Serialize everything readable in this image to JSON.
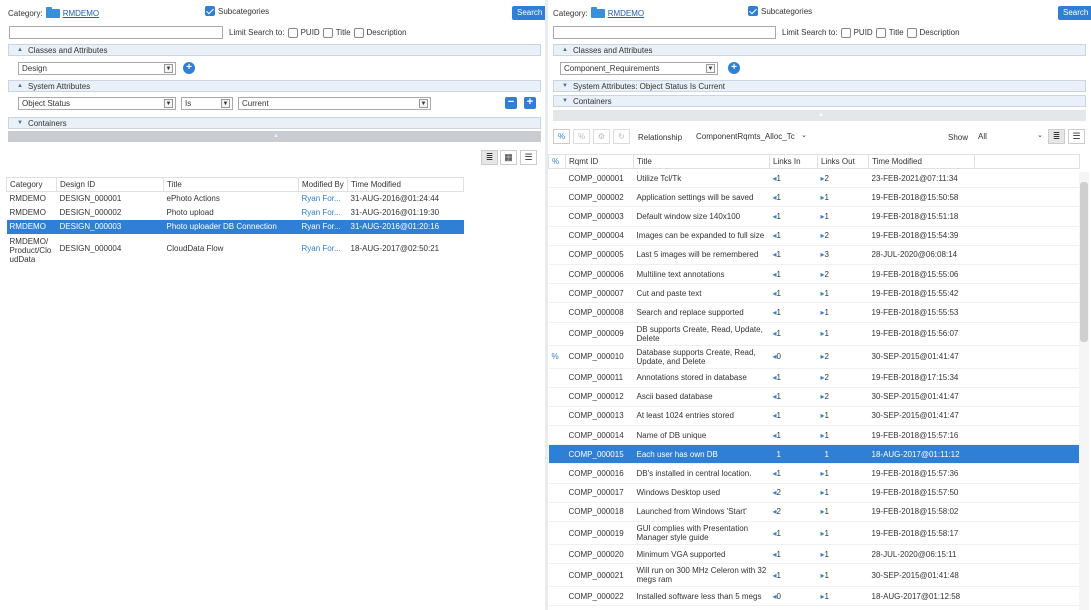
{
  "left": {
    "category_label": "Category:",
    "category_value": "RMDEMO",
    "subcategories_label": "Subcategories",
    "search_button": "Search",
    "limit_label": "Limit Search to:",
    "limit_options": [
      "PUID",
      "Title",
      "Description"
    ],
    "section_classes": "Classes and Attributes",
    "class_select": "Design",
    "section_system": "System Attributes",
    "attr_select": "Object Status",
    "op_select": "Is",
    "value_select": "Current",
    "section_containers": "Containers",
    "table": {
      "headers": [
        "Category",
        "Design ID",
        "Title",
        "Modified By",
        "Time Modified"
      ],
      "rows": [
        {
          "category": "RMDEMO",
          "id": "DESIGN_000001",
          "title": "ePhoto Actions",
          "by": "Ryan For...",
          "time": "31-AUG-2016@01:24:44"
        },
        {
          "category": "RMDEMO",
          "id": "DESIGN_000002",
          "title": "Photo upload",
          "by": "Ryan For...",
          "time": "31-AUG-2016@01:19:30"
        },
        {
          "category": "RMDEMO",
          "id": "DESIGN_000003",
          "title": "Photo uploader DB Connection",
          "by": "Ryan For...",
          "time": "31-AUG-2016@01:20:16"
        },
        {
          "category_lines": [
            "RMDEMO/",
            "Product/Clo",
            "udData"
          ],
          "id": "DESIGN_000004",
          "title": "CloudData Flow",
          "by": "Ryan For...",
          "time": "18-AUG-2017@02:50:21"
        }
      ]
    }
  },
  "right": {
    "category_label": "Category:",
    "category_value": "RMDEMO",
    "subcategories_label": "Subcategories",
    "search_button": "Search",
    "limit_label": "Limit Search to:",
    "limit_options": [
      "PUID",
      "Title",
      "Description"
    ],
    "section_classes": "Classes and Attributes",
    "class_select": "Component_Requirements",
    "section_system": "System Attributes: Object Status Is Current",
    "section_containers": "Containers",
    "relationship_label": "Relationship",
    "relationship_value": "ComponentRqmts_Alloc_Tc",
    "show_label": "Show",
    "show_value": "All",
    "table": {
      "headers": [
        "Rqmt ID",
        "Title",
        "Links In",
        "Links Out",
        "Time Modified"
      ],
      "rows": [
        {
          "id": "COMP_000001",
          "title": [
            "Utilize Tcl/Tk"
          ],
          "in": "1",
          "out": "2",
          "time": "23-FEB-2021@07:11:34"
        },
        {
          "id": "COMP_000002",
          "title": [
            "Application settings will be saved"
          ],
          "in": "1",
          "out": "1",
          "time": "19-FEB-2018@15:50:58"
        },
        {
          "id": "COMP_000003",
          "title": [
            "Default window size 140x100"
          ],
          "in": "1",
          "out": "1",
          "time": "19-FEB-2018@15:51:18"
        },
        {
          "id": "COMP_000004",
          "title": [
            "Images can be expanded to full size"
          ],
          "in": "1",
          "out": "2",
          "time": "19-FEB-2018@15:54:39"
        },
        {
          "id": "COMP_000005",
          "title": [
            "Last 5 images will be remembered"
          ],
          "in": "1",
          "out": "3",
          "time": "28-JUL-2020@06:08:14"
        },
        {
          "id": "COMP_000006",
          "title": [
            "Multiline text annotations"
          ],
          "in": "1",
          "out": "2",
          "time": "19-FEB-2018@15:55:06"
        },
        {
          "id": "COMP_000007",
          "title": [
            "Cut and paste text"
          ],
          "in": "1",
          "out": "1",
          "time": "19-FEB-2018@15:55:42"
        },
        {
          "id": "COMP_000008",
          "title": [
            "Search and replace supported"
          ],
          "in": "1",
          "out": "1",
          "time": "19-FEB-2018@15:55:53"
        },
        {
          "id": "COMP_000009",
          "title": [
            "DB supports Create, Read, Update,",
            "Delete"
          ],
          "in": "1",
          "out": "1",
          "time": "19-FEB-2018@15:56:07"
        },
        {
          "id": "COMP_000010",
          "title": [
            "Database supports Create, Read,",
            "Update, and Delete"
          ],
          "in": "0",
          "out": "2",
          "time": "30-SEP-2015@01:41:47",
          "linked": true
        },
        {
          "id": "COMP_000011",
          "title": [
            "Annotations stored in database"
          ],
          "in": "1",
          "out": "2",
          "time": "19-FEB-2018@17:15:34"
        },
        {
          "id": "COMP_000012",
          "title": [
            "Ascii based database"
          ],
          "in": "1",
          "out": "2",
          "time": "30-SEP-2015@01:41:47"
        },
        {
          "id": "COMP_000013",
          "title": [
            "At least 1024 entries stored"
          ],
          "in": "1",
          "out": "1",
          "time": "30-SEP-2015@01:41:47"
        },
        {
          "id": "COMP_000014",
          "title": [
            "Name of DB unique"
          ],
          "in": "1",
          "out": "1",
          "time": "19-FEB-2018@15:57:16"
        },
        {
          "id": "COMP_000015",
          "title": [
            "Each user has own DB"
          ],
          "in": "1",
          "out": "1",
          "time": "18-AUG-2017@01:11:12",
          "selected": true
        },
        {
          "id": "COMP_000016",
          "title": [
            "DB's installed in central location."
          ],
          "in": "1",
          "out": "1",
          "time": "19-FEB-2018@15:57:36"
        },
        {
          "id": "COMP_000017",
          "title": [
            "Windows Desktop used"
          ],
          "in": "2",
          "out": "1",
          "time": "19-FEB-2018@15:57:50"
        },
        {
          "id": "COMP_000018",
          "title": [
            "Launched from Windows 'Start'"
          ],
          "in": "2",
          "out": "1",
          "time": "19-FEB-2018@15:58:02"
        },
        {
          "id": "COMP_000019",
          "title": [
            "GUI complies with Presentation",
            "Manager style guide"
          ],
          "in": "1",
          "out": "1",
          "time": "19-FEB-2018@15:58:17"
        },
        {
          "id": "COMP_000020",
          "title": [
            "Minimum VGA supported"
          ],
          "in": "1",
          "out": "1",
          "time": "28-JUL-2020@06:15:11"
        },
        {
          "id": "COMP_000021",
          "title": [
            "Will run on 300 MHz Celeron with 32",
            "megs ram"
          ],
          "in": "1",
          "out": "1",
          "time": "30-SEP-2015@01:41:48"
        },
        {
          "id": "COMP_000022",
          "title": [
            "Installed software less than 5 megs"
          ],
          "in": "0",
          "out": "1",
          "time": "18-AUG-2017@01:12:58"
        }
      ]
    }
  },
  "colors": {
    "accent": "#2f7fd6",
    "section_bg": "#eaf0f7"
  }
}
